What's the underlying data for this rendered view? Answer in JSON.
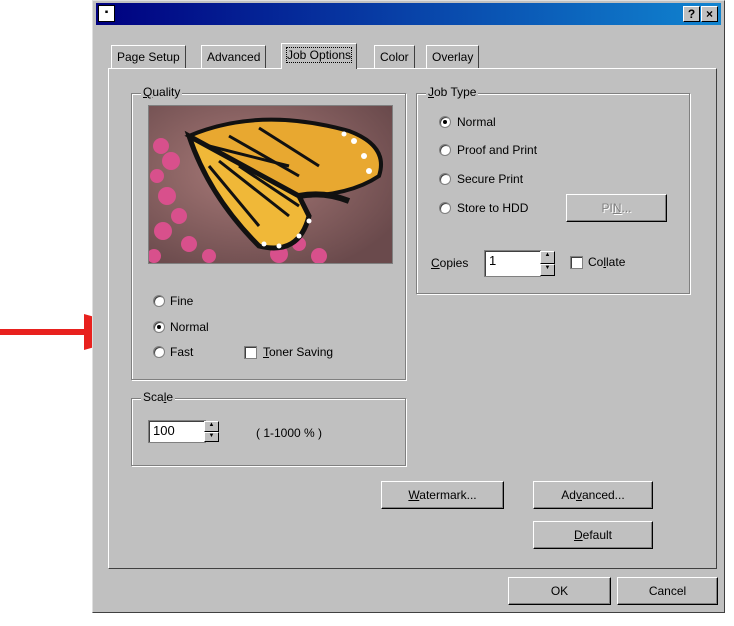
{
  "dialog": {
    "help_label": "?",
    "close_label": "×"
  },
  "tabs": [
    {
      "label": "Page Setup"
    },
    {
      "label": "Advanced"
    },
    {
      "label": "Job Options"
    },
    {
      "label": "Color"
    },
    {
      "label": "Overlay"
    }
  ],
  "quality": {
    "legend_ul": "Q",
    "legend_rest": "uality",
    "options": [
      {
        "label": "Fine",
        "selected": false
      },
      {
        "label": "Normal",
        "selected": true
      },
      {
        "label": "Fast",
        "selected": false
      }
    ],
    "toner_ul": "T",
    "toner_rest": "oner Saving",
    "toner_checked": false
  },
  "scale": {
    "legend_pre": "Sca",
    "legend_ul": "l",
    "legend_post": "e",
    "value": "100",
    "range_label": "( 1-1000 % )"
  },
  "job_type": {
    "legend_ul": "J",
    "legend_rest": "ob Type",
    "options": [
      {
        "label": "Normal",
        "selected": true
      },
      {
        "label": "Proof and Print",
        "selected": false
      },
      {
        "label": "Secure Print",
        "selected": false
      },
      {
        "label": "Store to HDD",
        "selected": false
      }
    ],
    "pin_pre": "PI",
    "pin_ul": "N",
    "pin_post": "...",
    "copies_ul": "C",
    "copies_rest": "opies",
    "copies_value": "1",
    "collate_pre": "Co",
    "collate_ul": "l",
    "collate_post": "late",
    "collate_checked": false
  },
  "buttons": {
    "watermark_ul": "W",
    "watermark_rest": "atermark...",
    "advanced_pre": "Ad",
    "advanced_ul": "v",
    "advanced_post": "anced...",
    "default_ul": "D",
    "default_rest": "efault",
    "ok": "OK",
    "cancel": "Cancel"
  },
  "colors": {
    "title_start": "#000080",
    "title_end": "#1084d0",
    "face": "#c0c0c0",
    "arrow": "#e8211e"
  }
}
